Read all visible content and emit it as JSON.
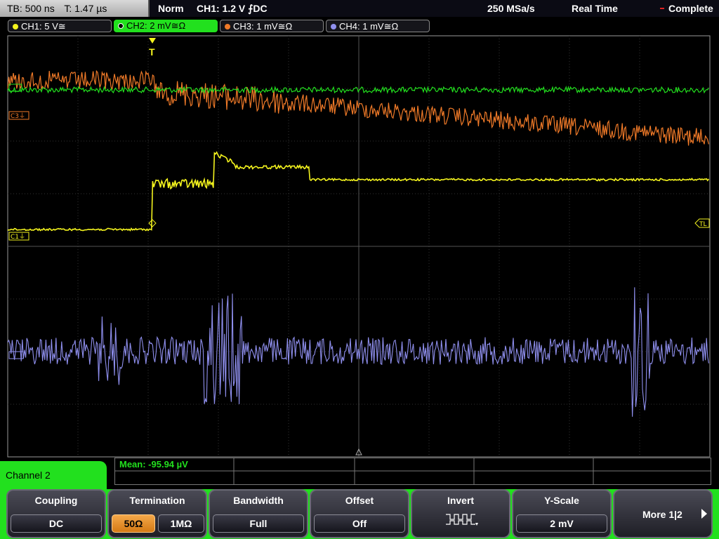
{
  "topbar": {
    "timebase": "TB: 500 ns",
    "trigger_time": "T: 1.47 µs",
    "mode": "Norm",
    "trigger_info": "CH1: 1.2 V ⨍DC",
    "sample_rate": "250 MSa/s",
    "acq_mode": "Real Time",
    "status": "Complete"
  },
  "channels": [
    {
      "label": "CH1: 5 V≅",
      "color": "#f4f41e",
      "active": false
    },
    {
      "label": "CH2: 2 mV≅Ω",
      "color": "#22e01e",
      "active": true
    },
    {
      "label": "CH3: 1 mV≅Ω",
      "color": "#f07a28",
      "active": false
    },
    {
      "label": "CH4: 1 mV≅Ω",
      "color": "#9090ee",
      "active": false
    }
  ],
  "markers": {
    "trigger": "T",
    "ch3": "C3⏚",
    "ch1": "C1⏚",
    "trigger_level": "TL"
  },
  "measurement": {
    "mean": "Mean: -95.94 µV"
  },
  "menu": {
    "title": "Channel 2",
    "coupling": {
      "title": "Coupling",
      "value": "DC"
    },
    "termination": {
      "title": "Termination",
      "opt1": "50Ω",
      "opt2": "1MΩ",
      "selected": "50Ω"
    },
    "bandwidth": {
      "title": "Bandwidth",
      "value": "Full"
    },
    "offset": {
      "title": "Offset",
      "value": "Off"
    },
    "invert": {
      "title": "Invert",
      "icon": "invert-waveform-icon"
    },
    "yscale": {
      "title": "Y-Scale",
      "value": "2 mV"
    },
    "more": {
      "label": "More 1|2"
    }
  }
}
